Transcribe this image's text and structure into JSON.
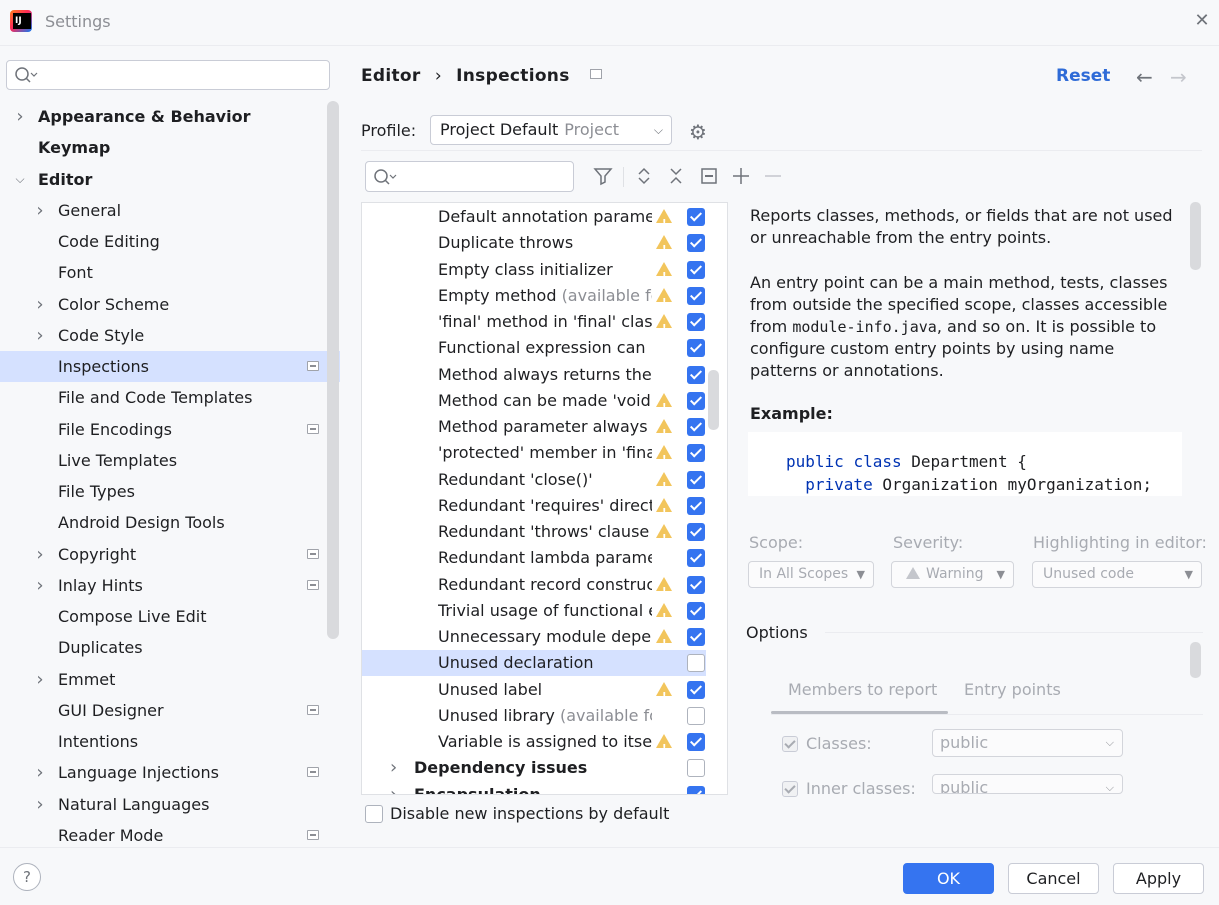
{
  "window": {
    "title": "Settings",
    "close_icon": "close-icon"
  },
  "search": {
    "placeholder": ""
  },
  "sidebar": {
    "items": [
      {
        "label": "Appearance & Behavior",
        "level": 0,
        "expandable": true,
        "bold": true
      },
      {
        "label": "Keymap",
        "level": 0,
        "expandable": false,
        "bold": true
      },
      {
        "label": "Editor",
        "level": 0,
        "expandable": true,
        "expanded": true,
        "bold": true
      },
      {
        "label": "General",
        "level": 1,
        "expandable": true
      },
      {
        "label": "Code Editing",
        "level": 1
      },
      {
        "label": "Font",
        "level": 1
      },
      {
        "label": "Color Scheme",
        "level": 1,
        "expandable": true
      },
      {
        "label": "Code Style",
        "level": 1,
        "expandable": true
      },
      {
        "label": "Inspections",
        "level": 1,
        "selected": true,
        "badge": true
      },
      {
        "label": "File and Code Templates",
        "level": 1
      },
      {
        "label": "File Encodings",
        "level": 1,
        "badge": true
      },
      {
        "label": "Live Templates",
        "level": 1
      },
      {
        "label": "File Types",
        "level": 1
      },
      {
        "label": "Android Design Tools",
        "level": 1
      },
      {
        "label": "Copyright",
        "level": 1,
        "expandable": true,
        "badge": true
      },
      {
        "label": "Inlay Hints",
        "level": 1,
        "expandable": true,
        "badge": true
      },
      {
        "label": "Compose Live Edit",
        "level": 1
      },
      {
        "label": "Duplicates",
        "level": 1
      },
      {
        "label": "Emmet",
        "level": 1,
        "expandable": true
      },
      {
        "label": "GUI Designer",
        "level": 1,
        "badge": true
      },
      {
        "label": "Intentions",
        "level": 1
      },
      {
        "label": "Language Injections",
        "level": 1,
        "expandable": true,
        "badge": true
      },
      {
        "label": "Natural Languages",
        "level": 1,
        "expandable": true
      },
      {
        "label": "Reader Mode",
        "level": 1,
        "badge": true
      }
    ]
  },
  "header": {
    "breadcrumb": [
      "Editor",
      "Inspections"
    ],
    "separator": "›",
    "reset": "Reset",
    "back_icon": "←",
    "forward_icon": "→"
  },
  "profile": {
    "label": "Profile:",
    "name": "Project Default",
    "scope": "Project"
  },
  "inspections": {
    "rows": [
      {
        "text": "Default annotation paramete",
        "gray": "",
        "warn": true,
        "checked": true
      },
      {
        "text": "Duplicate throws",
        "gray": "",
        "warn": true,
        "checked": true
      },
      {
        "text": "Empty class initializer",
        "gray": "",
        "warn": true,
        "checked": true
      },
      {
        "text": "Empty method ",
        "gray": "(available for",
        "warn": true,
        "checked": true
      },
      {
        "text": "'final' method in 'final' class",
        "gray": "",
        "warn": true,
        "checked": true
      },
      {
        "text": "Functional expression can b",
        "gray": "",
        "warn": false,
        "checked": true
      },
      {
        "text": "Method always returns the s",
        "gray": "",
        "warn": false,
        "checked": true
      },
      {
        "text": "Method can be made 'void'",
        "gray": "",
        "warn": true,
        "checked": true
      },
      {
        "text": "Method parameter always h",
        "gray": "",
        "warn": true,
        "checked": true
      },
      {
        "text": "'protected' member in 'final'",
        "gray": "",
        "warn": true,
        "checked": true
      },
      {
        "text": "Redundant 'close()'",
        "gray": "",
        "warn": true,
        "checked": true
      },
      {
        "text": "Redundant 'requires' directiv",
        "gray": "",
        "warn": true,
        "checked": true
      },
      {
        "text": "Redundant 'throws' clause",
        "gray": "",
        "warn": true,
        "checked": true
      },
      {
        "text": "Redundant lambda paramete",
        "gray": "",
        "warn": false,
        "checked": true
      },
      {
        "text": "Redundant record construct",
        "gray": "",
        "warn": true,
        "checked": true
      },
      {
        "text": "Trivial usage of functional e",
        "gray": "",
        "warn": true,
        "checked": true
      },
      {
        "text": "Unnecessary module depen",
        "gray": "",
        "warn": true,
        "checked": true
      },
      {
        "text": "Unused declaration",
        "gray": "",
        "warn": false,
        "checked": false,
        "selected": true
      },
      {
        "text": "Unused label",
        "gray": "",
        "warn": true,
        "checked": true
      },
      {
        "text": "Unused library ",
        "gray": "(available for",
        "warn": false,
        "checked": false
      },
      {
        "text": "Variable is assigned to itsel",
        "gray": "",
        "warn": true,
        "checked": true
      }
    ],
    "groups": [
      {
        "text": "Dependency issues",
        "checked": false
      },
      {
        "text": "Encapsulation",
        "checked": true
      }
    ]
  },
  "disable_new": {
    "label": "Disable new inspections by default",
    "checked": false
  },
  "description": {
    "p1": "Reports classes, methods, or fields that are not used or unreachable from the entry points.",
    "p2_a": "An entry point can be a main method, tests, classes from outside the specified scope, classes accessible from ",
    "p2_code": "module-info.java",
    "p2_b": ", and so on. It is possible to configure custom entry points by using name patterns or annotations.",
    "example_label": "Example:",
    "code_line1_kw1": "public",
    "code_line1_kw2": "class",
    "code_line1_rest": " Department {",
    "code_line2_kw": "private",
    "code_line2_rest": " Organization myOrganization;"
  },
  "settings": {
    "scope_label": "Scope:",
    "scope_value": "In All Scopes",
    "severity_label": "Severity:",
    "severity_value": "Warning",
    "highlight_label": "Highlighting in editor:",
    "highlight_value": "Unused code"
  },
  "options": {
    "label": "Options",
    "tabs": [
      "Members to report",
      "Entry points"
    ],
    "classes_label": "Classes:",
    "classes_value": "public",
    "inner_label": "Inner classes:",
    "inner_value": "public"
  },
  "footer": {
    "help": "?",
    "ok": "OK",
    "cancel": "Cancel",
    "apply": "Apply"
  },
  "colors": {
    "accent": "#3574f0",
    "selection": "#d5e1ff",
    "warning": "#f2c55c",
    "link": "#2f6bd7"
  }
}
